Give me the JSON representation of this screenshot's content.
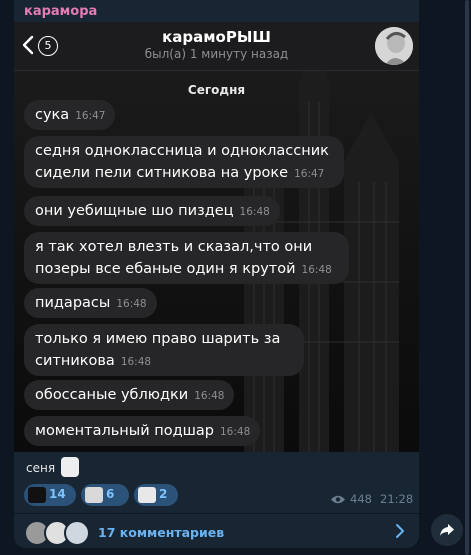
{
  "channel": {
    "name": "карамора"
  },
  "chat": {
    "back_count": "5",
    "title": "карамоРЫШ",
    "status": "был(а) 1 минуту назад",
    "date_label": "Сегодня",
    "messages": [
      {
        "text": "сука",
        "time": "16:47"
      },
      {
        "text": "седня одноклассница и одноклассник сидели пели ситникова на уроке",
        "time": "16:47"
      },
      {
        "text": "они уебищные шо пиздец",
        "time": "16:48"
      },
      {
        "text": "я так хотел влезть и сказал,что они позеры все ебаные один я крутой",
        "time": "16:48"
      },
      {
        "text": "пидарасы",
        "time": "16:48"
      },
      {
        "text": "только я имею право шарить за ситникова",
        "time": "16:48"
      },
      {
        "text": "обоссаные ублюдки",
        "time": "16:48"
      },
      {
        "text": "моментальный подшар",
        "time": "16:48"
      }
    ]
  },
  "reaction_line": {
    "name": "сеня"
  },
  "reactions": [
    {
      "icon": "sticker-icon",
      "count": "14"
    },
    {
      "icon": "sticker-icon",
      "count": "6"
    },
    {
      "icon": "sticker-icon",
      "count": "2"
    }
  ],
  "stats": {
    "views": "448",
    "time": "21:28"
  },
  "comments": {
    "label": "17 комментариев"
  },
  "colors": {
    "accent": "#6ab3f3",
    "channel_name": "#e57bb6",
    "bubble": "#262628",
    "panel": "#182533"
  }
}
